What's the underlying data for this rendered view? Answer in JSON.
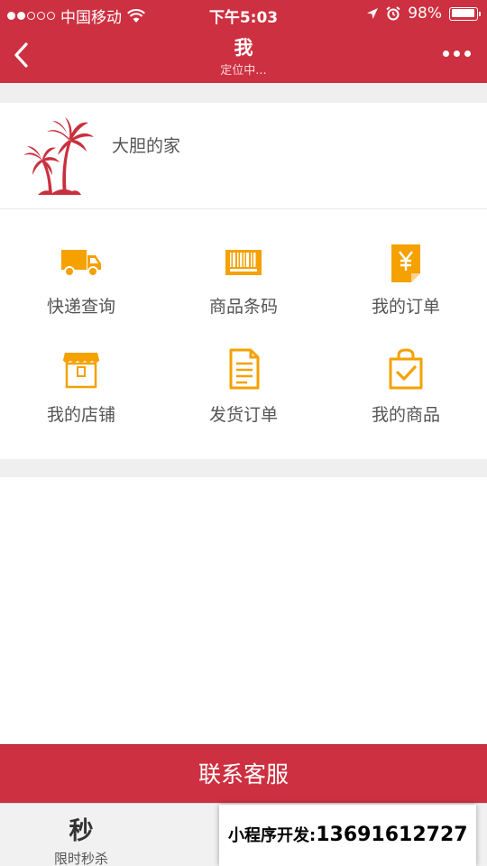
{
  "status_bar": {
    "carrier": "中国移动",
    "time": "下午5:03",
    "battery": "98%"
  },
  "nav": {
    "title": "我",
    "subtitle": "定位中..."
  },
  "profile": {
    "name": "大胆的家"
  },
  "menu": [
    {
      "label": "快递查询",
      "icon": "truck-icon"
    },
    {
      "label": "商品条码",
      "icon": "barcode-icon"
    },
    {
      "label": "我的订单",
      "icon": "yen-receipt-icon"
    },
    {
      "label": "我的店铺",
      "icon": "storefront-icon",
      "icon_text": "我的店铺"
    },
    {
      "label": "发货订单",
      "icon": "document-icon"
    },
    {
      "label": "我的商品",
      "icon": "checked-bag-icon"
    }
  ],
  "contact_button": "联系客服",
  "tabbar": {
    "first_glyph": "秒",
    "first_label": "限时秒杀"
  },
  "promo": {
    "label": "小程序开发:",
    "phone": "13691612727"
  },
  "colors": {
    "brand_red": "#cd3040",
    "icon_orange": "#f5a100"
  }
}
